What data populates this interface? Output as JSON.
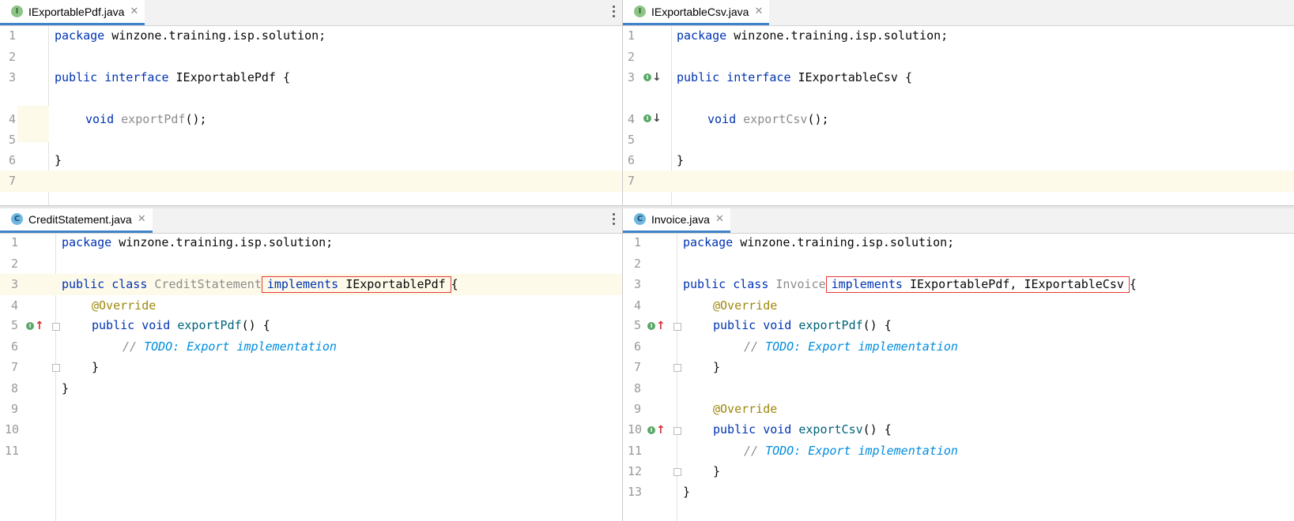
{
  "panes": [
    {
      "tab": {
        "icon": "I",
        "label": "IExportablePdf.java",
        "close": "✕"
      },
      "lines": [
        "1",
        "2",
        "3",
        "4",
        "5",
        "6",
        "7"
      ],
      "code": {
        "l1": [
          "package",
          "winzone.training.isp.solution;"
        ],
        "l3": [
          "public",
          "interface",
          "IExportablePdf {"
        ],
        "l4": [
          "void",
          "exportPdf",
          "();"
        ],
        "l6": "}"
      }
    },
    {
      "tab": {
        "icon": "I",
        "label": "IExportableCsv.java",
        "close": "✕"
      },
      "lines": [
        "1",
        "2",
        "3",
        "4",
        "5",
        "6",
        "7"
      ],
      "code": {
        "l1": [
          "package",
          "winzone.training.isp.solution;"
        ],
        "l3": [
          "public",
          "interface",
          "IExportableCsv {"
        ],
        "l4": [
          "void",
          "exportCsv",
          "();"
        ],
        "l6": "}"
      }
    },
    {
      "tab": {
        "icon": "C",
        "label": "CreditStatement.java",
        "close": "✕"
      },
      "lines": [
        "1",
        "2",
        "3",
        "4",
        "5",
        "6",
        "7",
        "8",
        "9",
        "10",
        "11"
      ],
      "code": {
        "l1": [
          "package",
          "winzone.training.isp.solution;"
        ],
        "l3": [
          "public class",
          "CreditStatement",
          "implements",
          "IExportablePdf",
          "{"
        ],
        "l4": "@Override",
        "l5": [
          "public void",
          "exportPdf",
          "() {"
        ],
        "l6": [
          "// ",
          "TODO: Export implementation"
        ],
        "l7": "}",
        "l8": "}"
      }
    },
    {
      "tab": {
        "icon": "C",
        "label": "Invoice.java",
        "close": "✕"
      },
      "lines": [
        "1",
        "2",
        "3",
        "4",
        "5",
        "6",
        "7",
        "8",
        "9",
        "10",
        "11",
        "12",
        "13"
      ],
      "code": {
        "l1": [
          "package",
          "winzone.training.isp.solution;"
        ],
        "l3": [
          "public class",
          "Invoice",
          "implements",
          "IExportablePdf, IExportableCsv",
          "{"
        ],
        "l4": "@Override",
        "l5": [
          "public void",
          "exportPdf",
          "() {"
        ],
        "l6": [
          "// ",
          "TODO: Export implementation"
        ],
        "l7": "}",
        "l9": "@Override",
        "l10": [
          "public void",
          "exportCsv",
          "() {"
        ],
        "l11": [
          "// ",
          "TODO: Export implementation"
        ],
        "l12": "}",
        "l13": "}"
      }
    }
  ],
  "gutter_icons": {
    "implemented": "I",
    "up_arrow": "↑",
    "down_arrow": "↓"
  },
  "colors": {
    "keyword": "#0033b3",
    "method": "#00627a",
    "annotation": "#9e880d",
    "todo": "#008dde",
    "highlight_box": "#e53935",
    "tab_underline": "#4083c9"
  }
}
